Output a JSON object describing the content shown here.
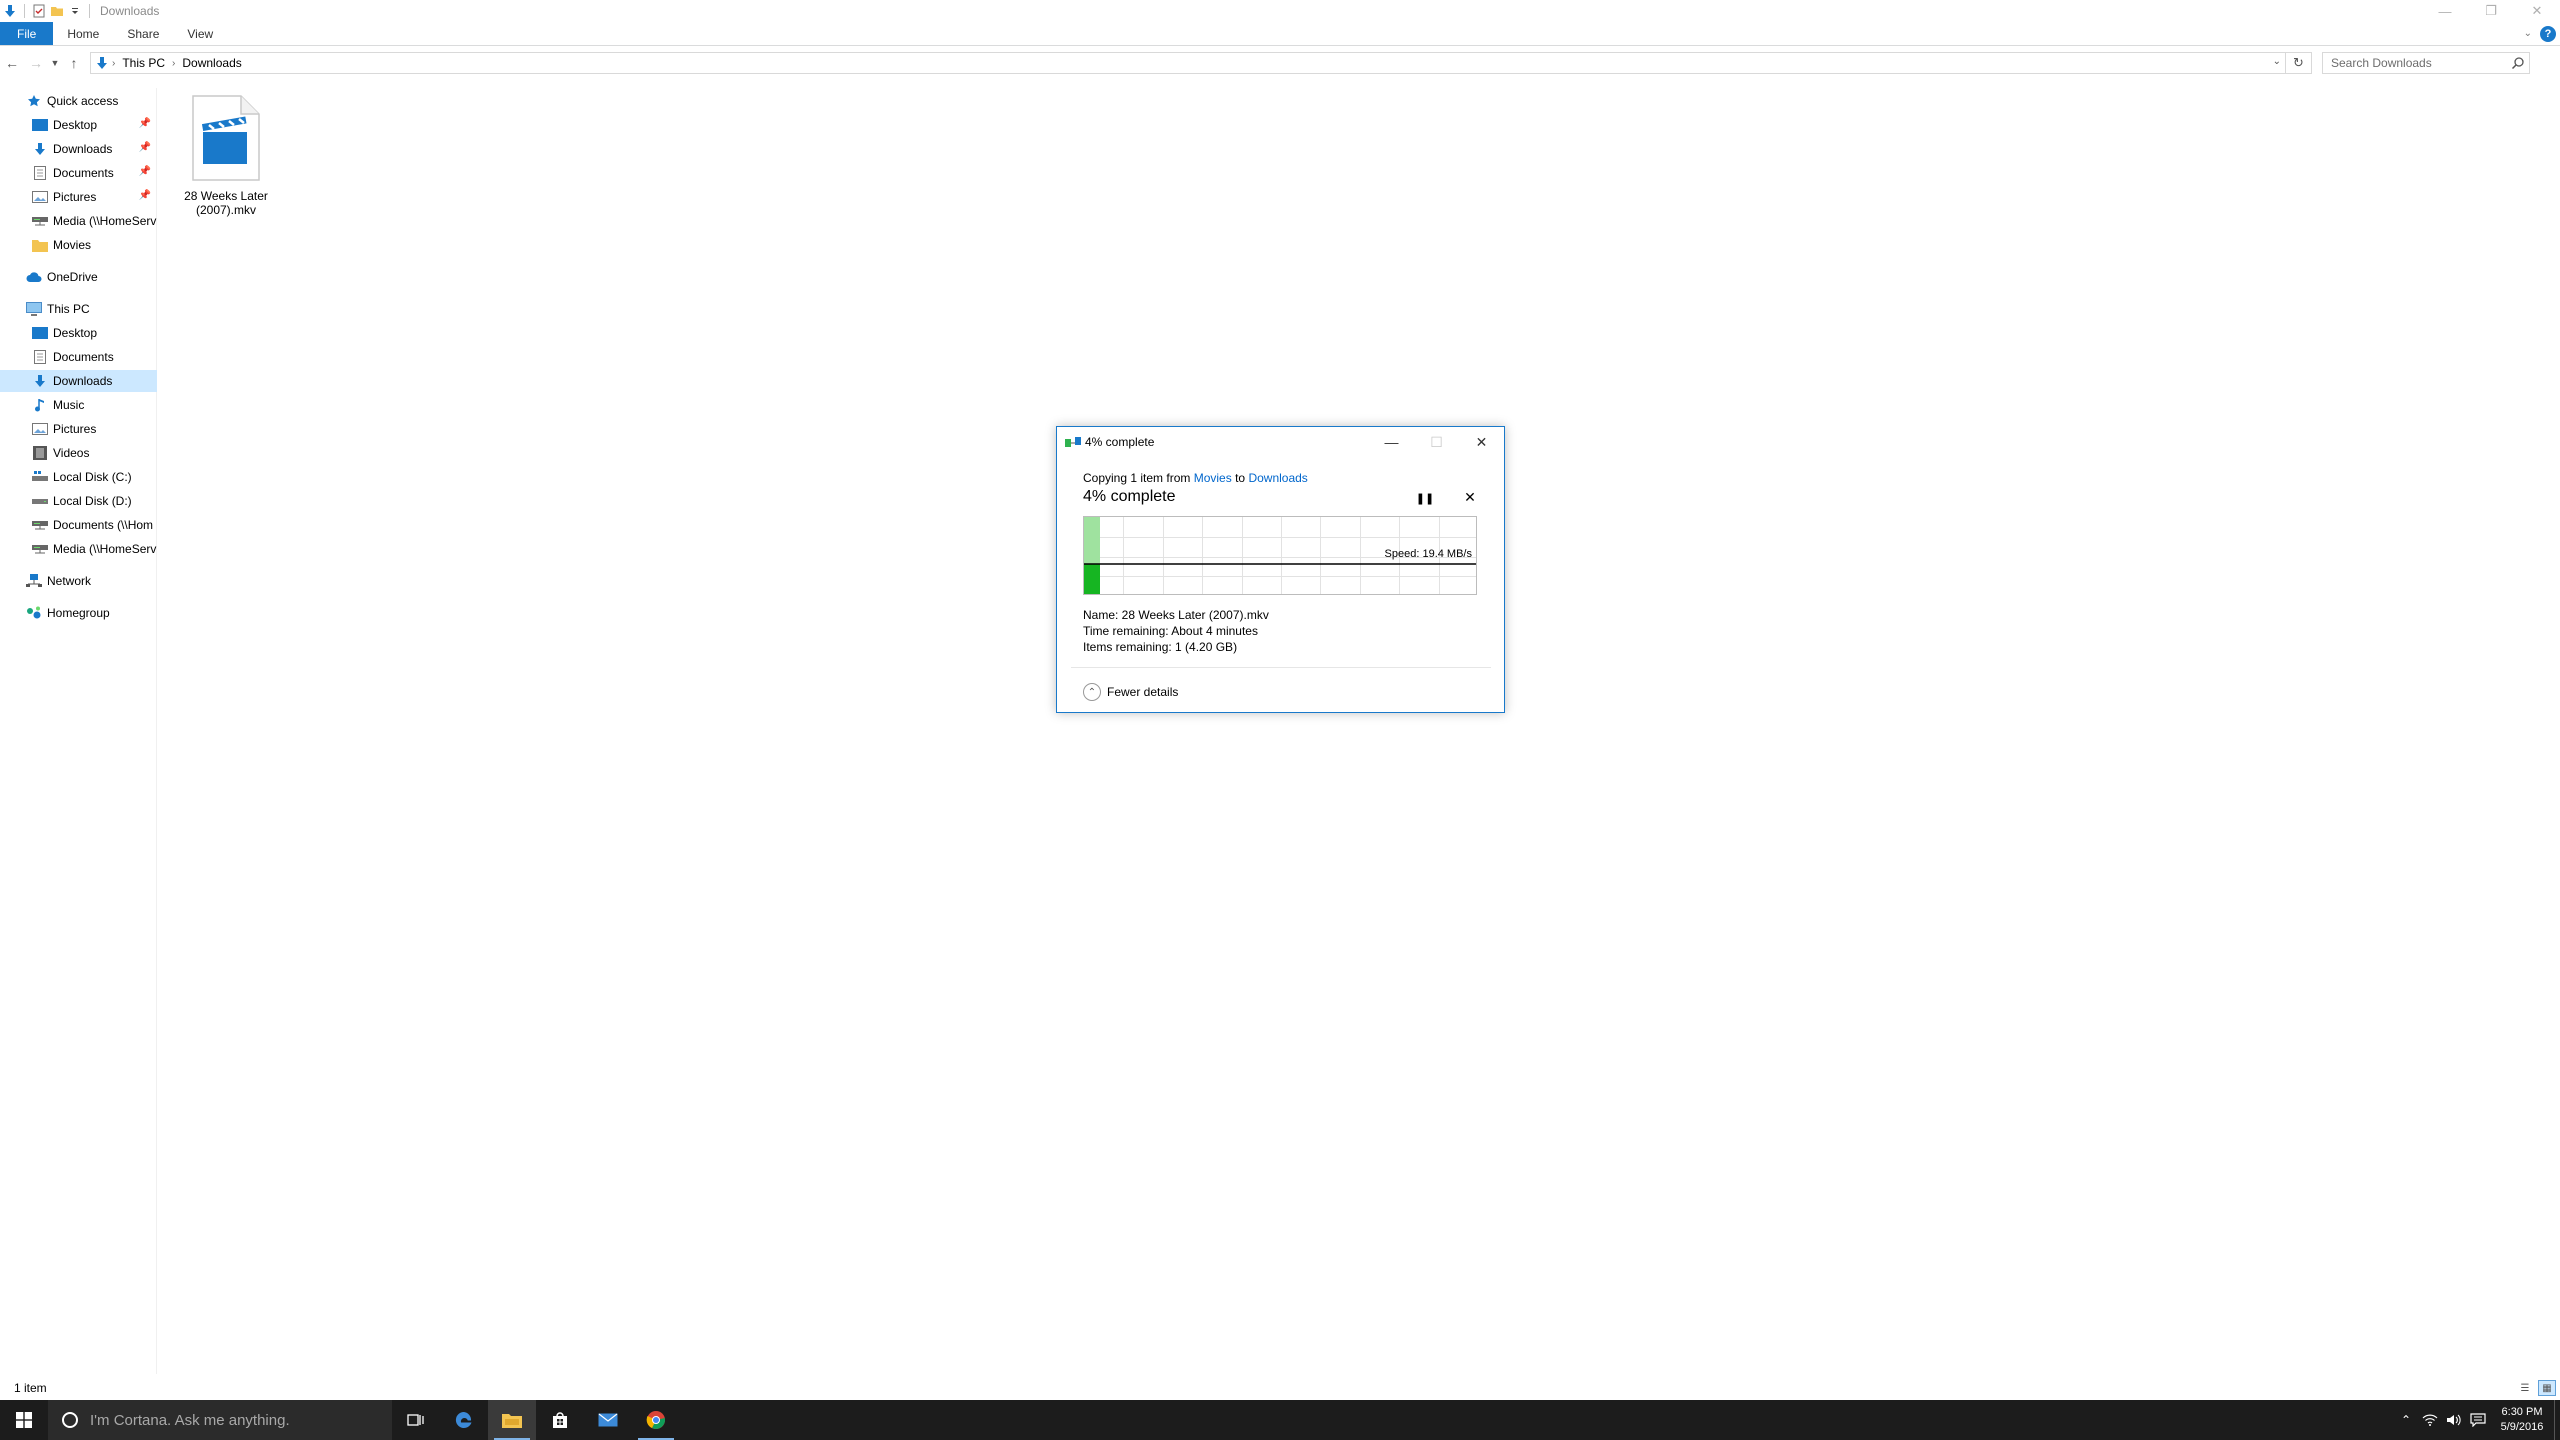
{
  "window": {
    "title": "Downloads"
  },
  "ribbon": {
    "tabs": [
      {
        "label": "File"
      },
      {
        "label": "Home"
      },
      {
        "label": "Share"
      },
      {
        "label": "View"
      }
    ]
  },
  "address": {
    "crumbs": [
      "This PC",
      "Downloads"
    ],
    "search_placeholder": "Search Downloads"
  },
  "nav": {
    "quick_access": "Quick access",
    "quick_items": [
      {
        "label": "Desktop",
        "pinned": true
      },
      {
        "label": "Downloads",
        "pinned": true
      },
      {
        "label": "Documents",
        "pinned": true
      },
      {
        "label": "Pictures",
        "pinned": true
      },
      {
        "label": "Media (\\\\HomeServ",
        "pinned": false
      },
      {
        "label": "Movies",
        "pinned": false
      }
    ],
    "onedrive": "OneDrive",
    "this_pc": "This PC",
    "pc_items": [
      {
        "label": "Desktop"
      },
      {
        "label": "Documents"
      },
      {
        "label": "Downloads",
        "selected": true
      },
      {
        "label": "Music"
      },
      {
        "label": "Pictures"
      },
      {
        "label": "Videos"
      },
      {
        "label": "Local Disk (C:)"
      },
      {
        "label": "Local Disk (D:)"
      },
      {
        "label": "Documents (\\\\Hom"
      },
      {
        "label": "Media (\\\\HomeServ"
      }
    ],
    "network": "Network",
    "homegroup": "Homegroup"
  },
  "content": {
    "files": [
      {
        "name_line1": "28 Weeks Later",
        "name_line2": "(2007).mkv",
        "icon": "video-file-icon"
      }
    ]
  },
  "dialog": {
    "title": "4% complete",
    "copying_prefix": "Copying 1 item from",
    "source": "Movies",
    "to_word": "to",
    "destination": "Downloads",
    "percent_text": "4% complete",
    "progress_fraction": 0.04,
    "speed": "Speed: 19.4 MB/s",
    "name_line": "Name:  28 Weeks Later (2007).mkv",
    "time_line": "Time remaining:  About 4 minutes",
    "items_line": "Items remaining:  1 (4.20 GB)",
    "fewer_details": "Fewer details",
    "colors": {
      "progress_light": "#9fe29f",
      "progress_dark": "#16b522",
      "speed_line": "#000000"
    }
  },
  "status": {
    "item_count": "1 item"
  },
  "taskbar": {
    "cortana_placeholder": "I'm Cortana. Ask me anything.",
    "time": "6:30 PM",
    "date": "5/9/2016",
    "apps": [
      "task-view-icon",
      "edge-icon",
      "file-explorer-icon",
      "store-icon",
      "mail-icon",
      "chrome-icon"
    ]
  }
}
